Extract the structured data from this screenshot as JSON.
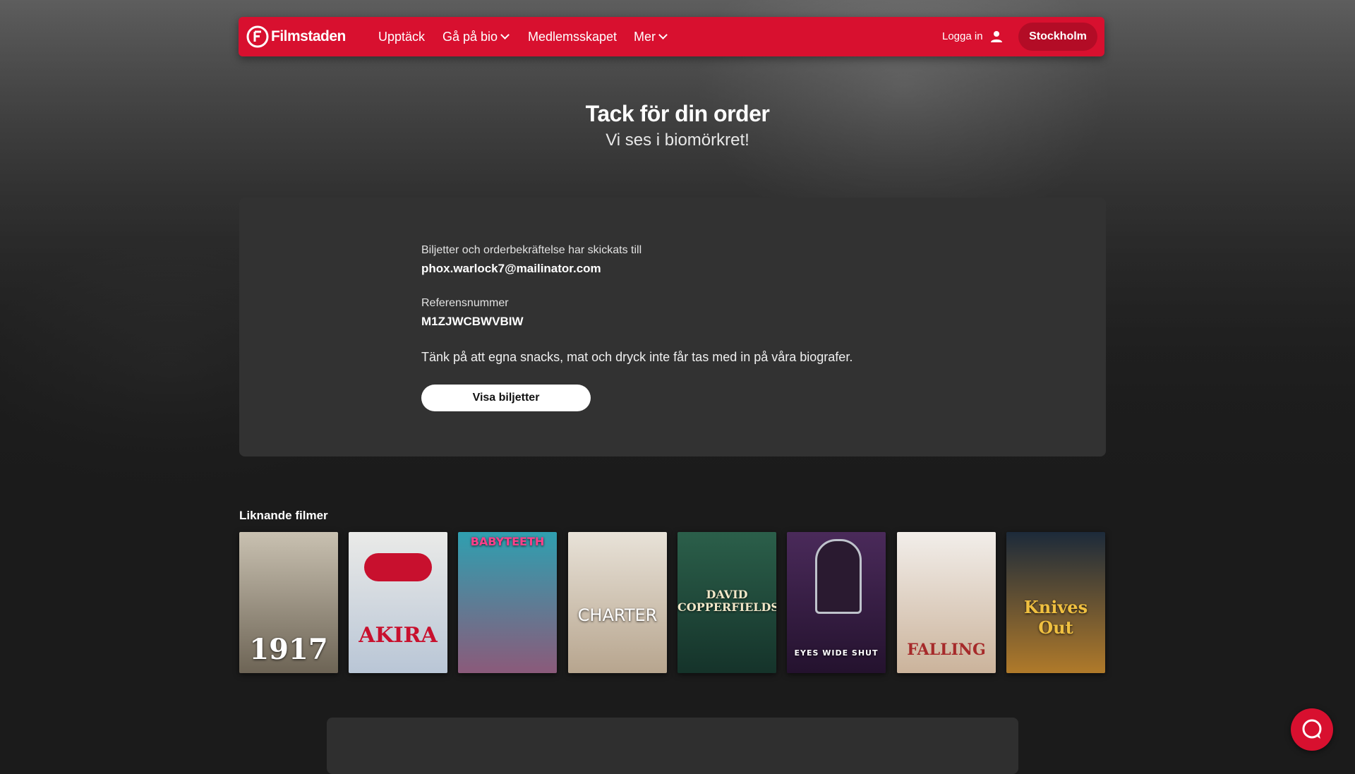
{
  "nav": {
    "logo_text": "Filmstaden",
    "links": [
      {
        "label": "Upptäck",
        "has_caret": false
      },
      {
        "label": "Gå på bio",
        "has_caret": true
      },
      {
        "label": "Medlemsskapet",
        "has_caret": false
      },
      {
        "label": "Mer",
        "has_caret": true
      }
    ],
    "login_label": "Logga in",
    "city_button": "Stockholm"
  },
  "hero": {
    "title": "Tack för din order",
    "subtitle": "Vi ses i biomörkret!"
  },
  "order": {
    "sent_to_label": "Biljetter och orderbekräftelse har skickats till",
    "email": "phox.warlock7@mailinator.com",
    "reference_label": "Referensnummer",
    "reference_number": "M1ZJWCBWVBIW",
    "note": "Tänk på att egna snacks, mat och dryck inte får tas med in på våra biografer.",
    "tickets_button": "Visa biljetter"
  },
  "similar": {
    "heading": "Liknande filmer",
    "movies": [
      {
        "title": "1917",
        "colors": [
          "#c9c1b1",
          "#6d6455"
        ]
      },
      {
        "title": "AKIRA",
        "colors": [
          "#eaeae8",
          "#b9c6d6"
        ]
      },
      {
        "title": "BABYTEETH",
        "colors": [
          "#2f9fb0",
          "#8b5a7a"
        ]
      },
      {
        "title": "CHARTER",
        "colors": [
          "#e8e2d8",
          "#b7a58e"
        ]
      },
      {
        "title": "DAVID COPPERFIELDS",
        "colors": [
          "#2b5f4a",
          "#15332a"
        ]
      },
      {
        "title": "EYES WIDE SHUT",
        "colors": [
          "#4a2a5a",
          "#24122e"
        ]
      },
      {
        "title": "FALLING",
        "colors": [
          "#f2eeea",
          "#cbb39b"
        ]
      },
      {
        "title": "Knives Out",
        "colors": [
          "#1c2a3a",
          "#b07a2a"
        ]
      }
    ]
  },
  "colors": {
    "brand_red": "#d8102f",
    "card_bg": "#323232",
    "page_bg": "#1b1b1b"
  }
}
